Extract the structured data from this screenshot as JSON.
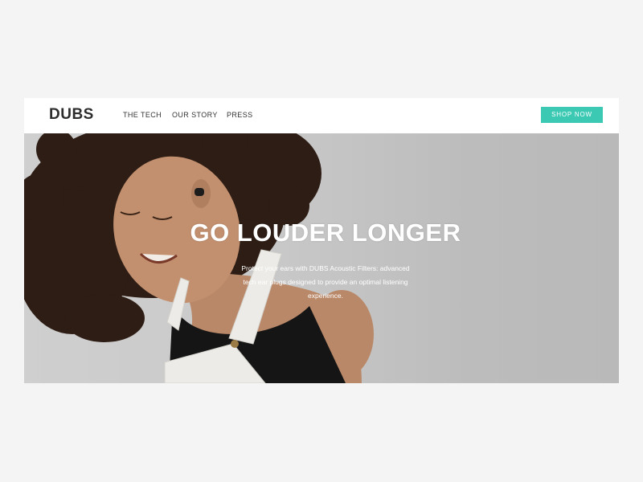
{
  "header": {
    "logo": "DUBS",
    "nav": [
      "THE TECH",
      "OUR STORY",
      "PRESS"
    ],
    "cta_label": "SHOP NOW"
  },
  "hero": {
    "title": "GO LOUDER LONGER",
    "subtitle": "Protect your ears with DUBS Acoustic Filters: advanced tech ear plugs designed to provide an optimal listening experience."
  },
  "colors": {
    "accent": "#3cc9b3",
    "page_background": "#f4f4f4",
    "hero_background": "#c4c4c4",
    "logo": "#2d2d2d"
  }
}
